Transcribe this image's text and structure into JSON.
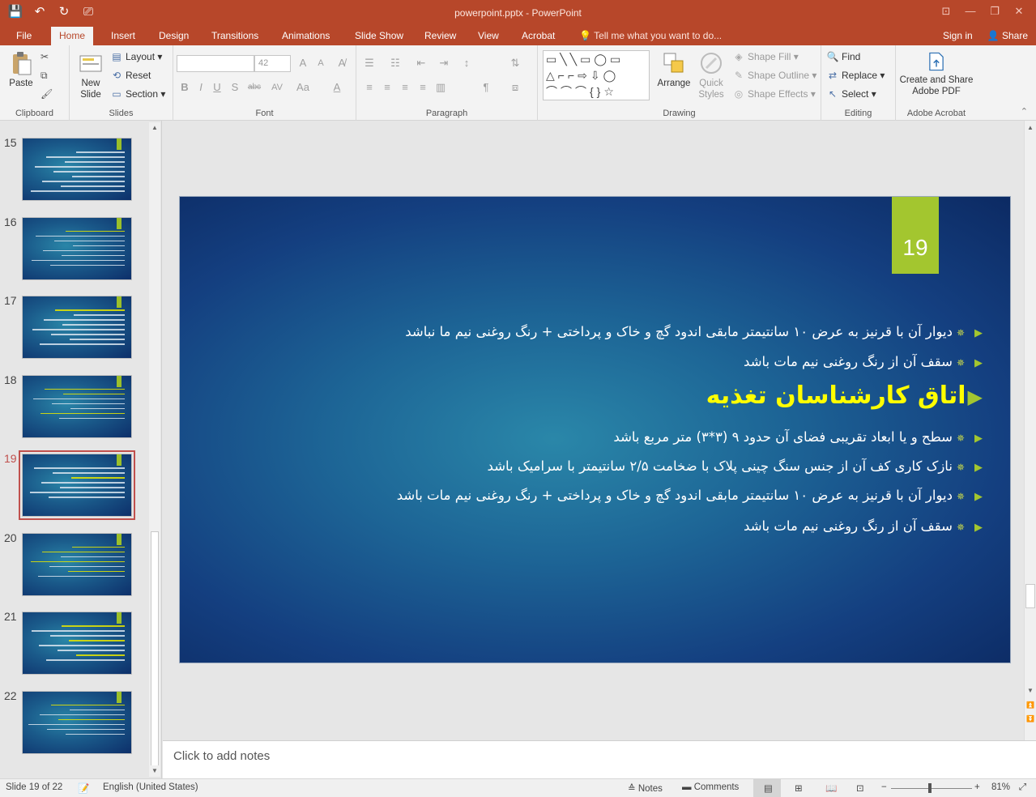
{
  "window": {
    "title": "powerpoint.pptx - PowerPoint",
    "min_label": "—",
    "max_label": "❐",
    "close_label": "✕",
    "ribbon_opts_label": "⊡"
  },
  "qat": {
    "save": "💾",
    "undo": "↶",
    "redo": "↻",
    "present": "⎚"
  },
  "tabs": [
    "File",
    "Home",
    "Insert",
    "Design",
    "Transitions",
    "Animations",
    "Slide Show",
    "Review",
    "View",
    "Acrobat"
  ],
  "tell_me": "Tell me what you want to do...",
  "signin": "Sign in",
  "share": "Share",
  "ribbon": {
    "clipboard": {
      "paste": "Paste",
      "label": "Clipboard"
    },
    "slides": {
      "new_slide": "New Slide",
      "layout": "Layout",
      "reset": "Reset",
      "section": "Section",
      "label": "Slides"
    },
    "font": {
      "font_size": "42",
      "label": "Font",
      "bold": "B",
      "italic": "I",
      "underline": "U",
      "shadow": "S",
      "strike": "abc",
      "spacing": "AV",
      "case": "Aa",
      "grow": "A",
      "shrink": "A"
    },
    "paragraph": {
      "label": "Paragraph"
    },
    "drawing": {
      "arrange": "Arrange",
      "quick_styles": "Quick Styles",
      "shape_fill": "Shape Fill",
      "shape_outline": "Shape Outline",
      "shape_effects": "Shape Effects",
      "label": "Drawing"
    },
    "editing": {
      "find": "Find",
      "replace": "Replace",
      "select": "Select",
      "label": "Editing"
    },
    "acrobat": {
      "create_share": "Create and Share Adobe PDF",
      "label": "Adobe Acrobat"
    }
  },
  "thumbnails": [
    {
      "num": "15",
      "lines": 9,
      "yellow": []
    },
    {
      "num": "16",
      "lines": 8,
      "yellow": [
        0
      ]
    },
    {
      "num": "17",
      "lines": 8,
      "yellow": [
        0
      ]
    },
    {
      "num": "18",
      "lines": 7,
      "yellow": [
        0,
        1,
        5
      ]
    },
    {
      "num": "19",
      "lines": 7,
      "yellow": [
        2
      ],
      "selected": true
    },
    {
      "num": "20",
      "lines": 7,
      "yellow": [
        0,
        1,
        3,
        5
      ]
    },
    {
      "num": "21",
      "lines": 8,
      "yellow": [
        0,
        3,
        6
      ]
    },
    {
      "num": "22",
      "lines": 7,
      "yellow": [
        0,
        3
      ]
    }
  ],
  "slide": {
    "number": "19",
    "bullets_top": [
      "دیوار آن با قرنیز به عرض ۱۰ سانتیمتر مابقی اندود گچ و خاک و پرداختی + رنگ روغنی نیم ما نباشد",
      "سقف آن از رنگ روغنی نیم مات باشد"
    ],
    "heading": "اتاق کارشناسان تغذیه",
    "bullets_bottom": [
      "سطح و یا ابعاد تقریبی فضای آن حدود ۹ (۳*۳) متر مربع باشد",
      "نازک کاری کف آن از جنس سنگ چینی پلاک با ضخامت ۲/۵ سانتیمتر با سرامیک باشد",
      "دیوار آن با قرنیز به عرض ۱۰ سانتیمتر مابقی اندود گچ و خاک و پرداختی + رنگ روغنی نیم مات باشد",
      "سقف آن از رنگ روغنی نیم مات باشد"
    ]
  },
  "notes_placeholder": "Click to add notes",
  "status": {
    "slide_info": "Slide 19 of 22",
    "language": "English (United States)",
    "notes": "Notes",
    "comments": "Comments",
    "zoom_minus": "−",
    "zoom_plus": "+",
    "zoom": "81%",
    "zoom_level": 0.48
  },
  "colors": {
    "accent": "#b7472a",
    "slide_tag": "#a3c62f",
    "heading": "#ffff00"
  }
}
